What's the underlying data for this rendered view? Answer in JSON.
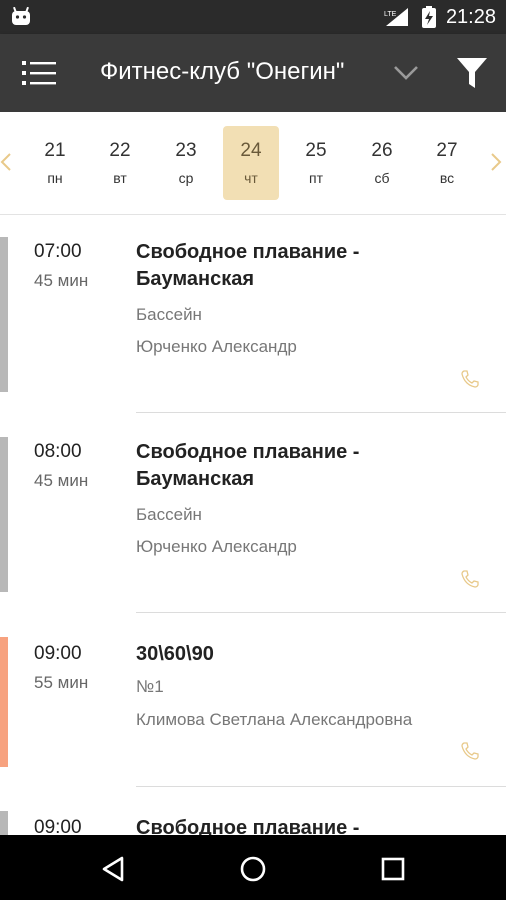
{
  "status_bar": {
    "time": "21:28",
    "network": "LTE"
  },
  "app_bar": {
    "title": "Фитнес-клуб \"Онегин\""
  },
  "dates": [
    {
      "num": "21",
      "wd": "пн",
      "selected": false
    },
    {
      "num": "22",
      "wd": "вт",
      "selected": false
    },
    {
      "num": "23",
      "wd": "ср",
      "selected": false
    },
    {
      "num": "24",
      "wd": "чт",
      "selected": true
    },
    {
      "num": "25",
      "wd": "пт",
      "selected": false
    },
    {
      "num": "26",
      "wd": "сб",
      "selected": false
    },
    {
      "num": "27",
      "wd": "вс",
      "selected": false
    }
  ],
  "sessions": [
    {
      "time": "07:00",
      "duration": "45 мин",
      "name": "Свободное плавание - Бауманская",
      "place": "Бассейн",
      "coach": "Юрченко Александр",
      "color": "#b8b8b8"
    },
    {
      "time": "08:00",
      "duration": "45 мин",
      "name": "Свободное плавание - Бауманская",
      "place": "Бассейн",
      "coach": "Юрченко Александр",
      "color": "#b8b8b8"
    },
    {
      "time": "09:00",
      "duration": "55 мин",
      "name": "30\\60\\90",
      "place": "№1",
      "coach": "Климова Светлана Александровна",
      "color": "#f7a27f"
    },
    {
      "time": "09:00",
      "duration": "",
      "name": "Свободное плавание -",
      "place": "",
      "coach": "",
      "color": "#b8b8b8"
    }
  ],
  "colors": {
    "accent": "#f2dfb4",
    "phone": "#e8c98a",
    "app_bar": "#3a3a3a"
  },
  "icons": {
    "menu": "list-menu-icon",
    "dropdown": "chevron-down-icon",
    "filter": "filter-funnel-icon",
    "phone": "phone-icon"
  }
}
